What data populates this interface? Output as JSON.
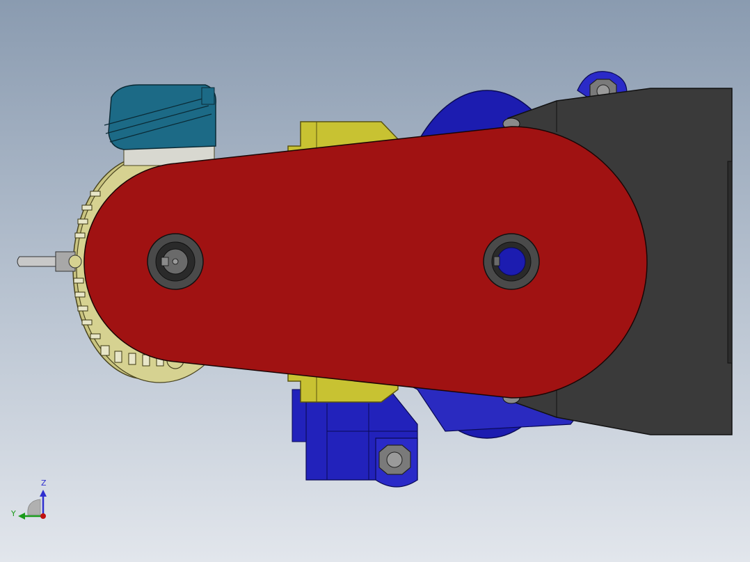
{
  "triad": {
    "z_label": "Z",
    "y_label": "Y"
  },
  "colors": {
    "background_top": "#8a9bb0",
    "background_bottom": "#e2e6ec",
    "belt_guard": "#a01212",
    "motor_frame": "#c9c480",
    "motor_yellow_bracket": "#c8c232",
    "terminal_box": "#1c6a86",
    "gearbox": "#1c1cb0",
    "housing": "#3a3a3a",
    "axis_z": "#2f2fcf",
    "axis_y": "#1a9a1a"
  }
}
